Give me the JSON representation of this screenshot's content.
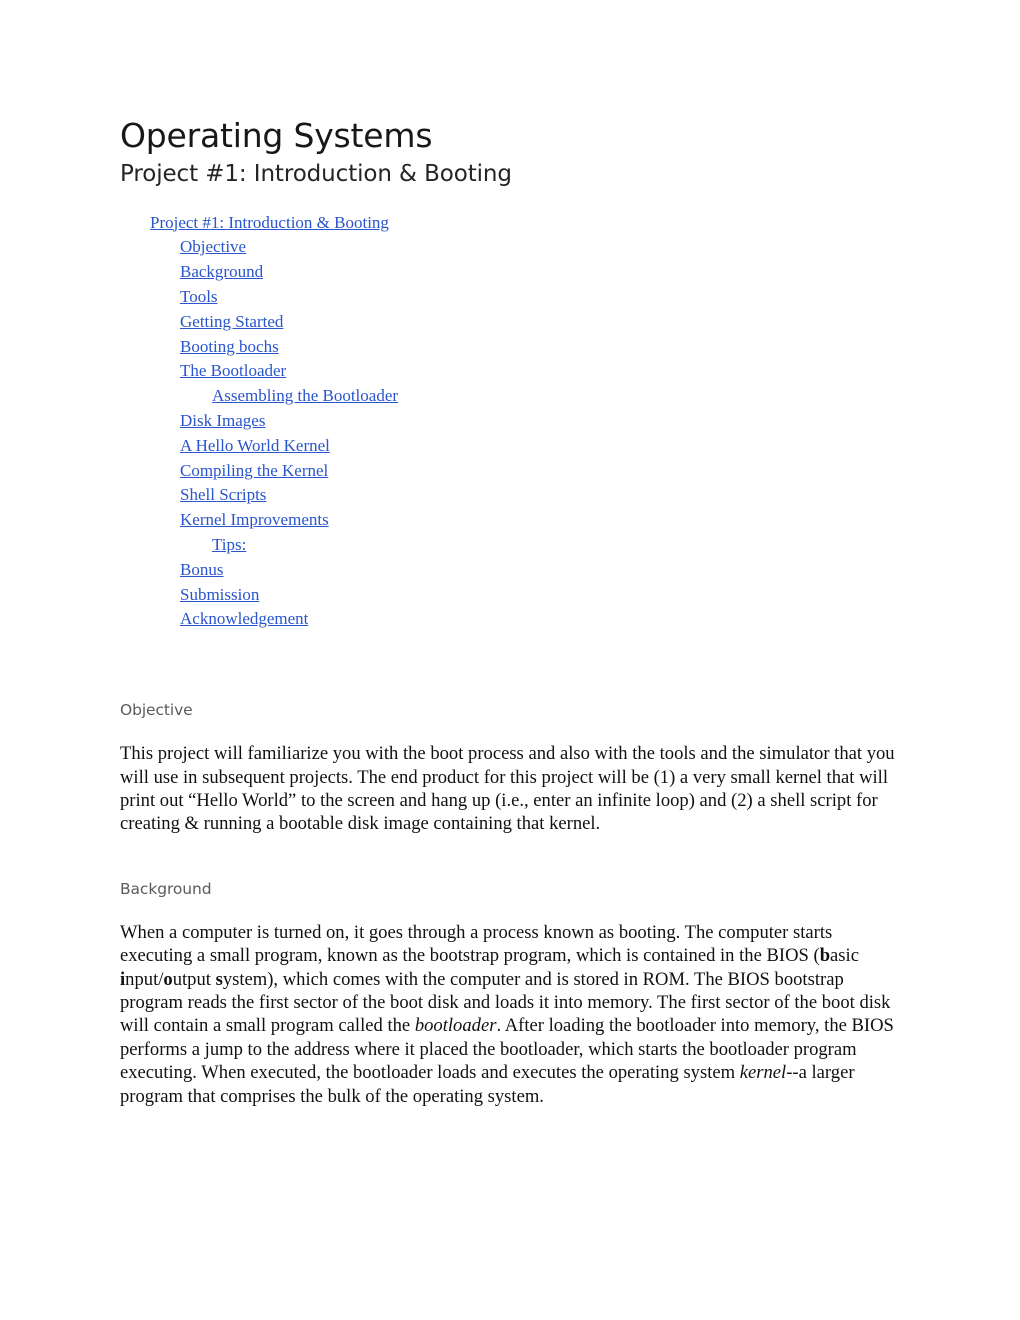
{
  "document": {
    "title": "Operating Systems",
    "subtitle": "Project #1: Introduction & Booting"
  },
  "toc": {
    "items": [
      {
        "label": "Project #1: Introduction & Booting",
        "level": 0
      },
      {
        "label": "Objective",
        "level": 1
      },
      {
        "label": "Background",
        "level": 1
      },
      {
        "label": "Tools",
        "level": 1
      },
      {
        "label": "Getting Started",
        "level": 1
      },
      {
        "label": "Booting bochs",
        "level": 1
      },
      {
        "label": "The Bootloader",
        "level": 1
      },
      {
        "label": "Assembling the Bootloader",
        "level": 2
      },
      {
        "label": "Disk Images",
        "level": 1
      },
      {
        "label": "A Hello World Kernel",
        "level": 1
      },
      {
        "label": "Compiling the Kernel",
        "level": 1
      },
      {
        "label": "Shell Scripts",
        "level": 1
      },
      {
        "label": "Kernel Improvements",
        "level": 1
      },
      {
        "label": "Tips:",
        "level": 2
      },
      {
        "label": "Bonus",
        "level": 1
      },
      {
        "label": "Submission",
        "level": 1
      },
      {
        "label": "Acknowledgement",
        "level": 1
      }
    ]
  },
  "sections": {
    "objective": {
      "heading": "Objective",
      "paragraph": "This project will familiarize you with the boot process and also with the tools and the simulator that you will use in subsequent projects. The end product for this project will be (1) a very small kernel that will print out “Hello World” to the screen and hang up (i.e., enter an infinite loop) and (2) a shell script for creating & running a bootable disk image containing that kernel."
    },
    "background": {
      "heading": "Background",
      "part1": "When a computer is turned on, it goes through a process known as booting.  The computer starts executing a small program, known as the bootstrap program, which is contained in the BIOS (",
      "bold_b": "b",
      "after_b": "asic ",
      "bold_i": "i",
      "after_i": "nput/",
      "bold_o": "o",
      "after_o": "utput ",
      "bold_s": "s",
      "after_s": "ystem), which comes with the computer and is stored in ROM.  The BIOS bootstrap program reads the first sector of the boot disk and loads it into memory.  The first sector of the boot disk will contain a small program called the ",
      "italic_bootloader": "bootloader",
      "after_bootloader": ".  After loading the bootloader into memory, the BIOS performs a jump to the address where it placed the bootloader, which starts the bootloader program executing. When executed, the bootloader loads and executes the operating system ",
      "italic_kernel": "kernel",
      "after_kernel": "--a larger program that comprises the bulk of the operating system."
    }
  },
  "colors": {
    "link": "#2a55cc",
    "heading": "#5b5b5b",
    "body_text": "#111111",
    "page_background": "#ffffff"
  }
}
